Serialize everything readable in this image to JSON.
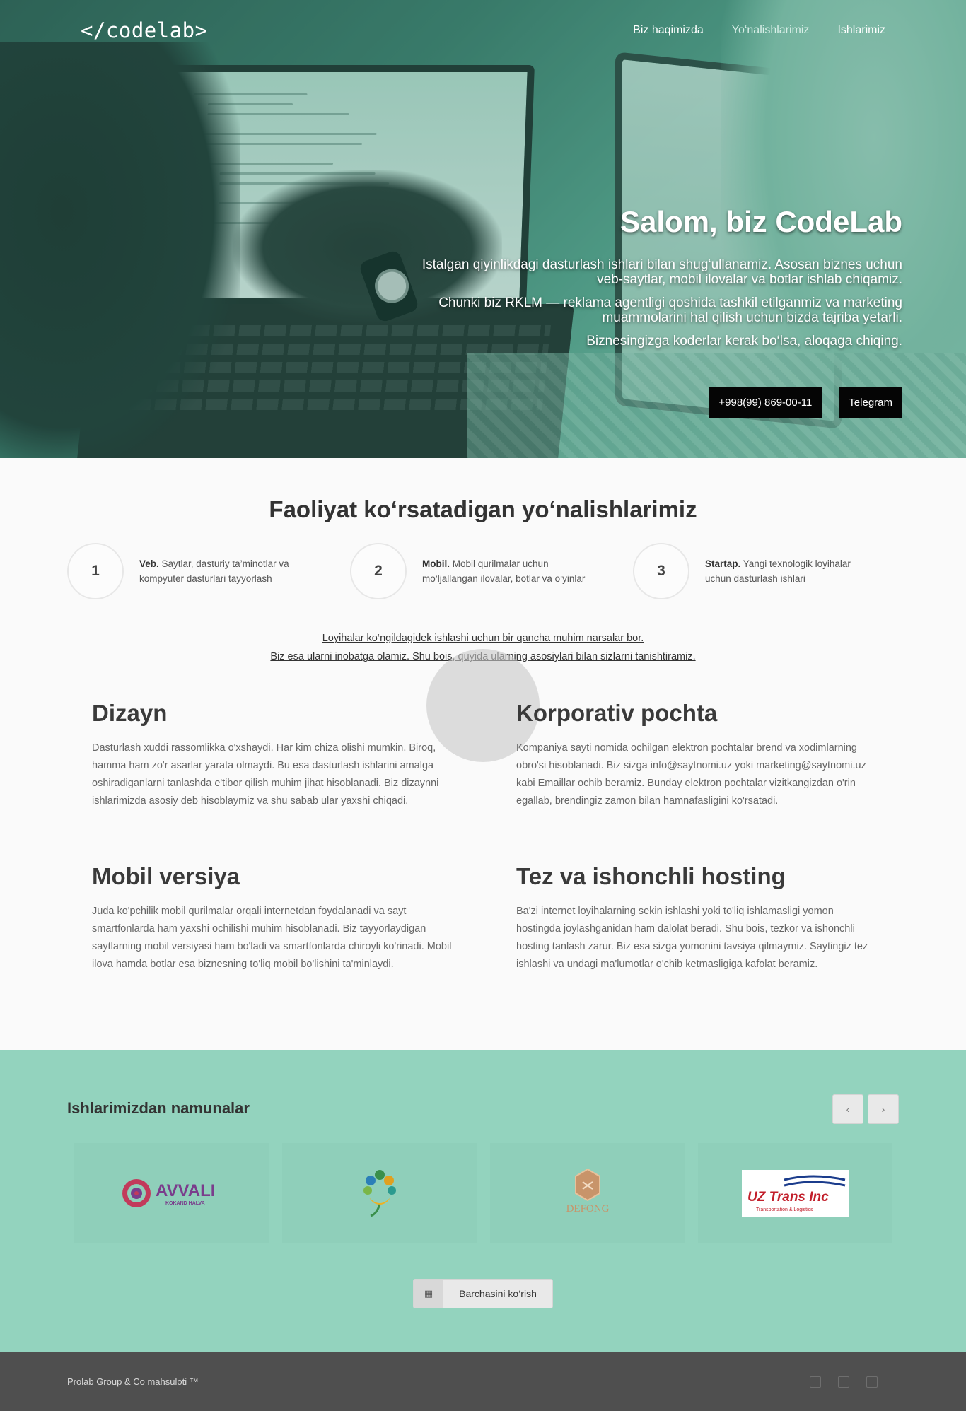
{
  "header": {
    "logo": "</codelab>",
    "nav": [
      "Biz haqimizda",
      "Yo‘nalishlarimiz",
      "Ishlarimiz"
    ]
  },
  "hero": {
    "title": "Salom, biz CodeLab",
    "p1": "Istalgan qiyinlikdagi dasturlash ishlari bilan shug‘ullanamiz. Asosan biznes uchun veb-saytlar, mobil ilovalar va botlar ishlab chiqamiz.",
    "p2": "Chunki biz RKLM — reklama agentligi qoshida tashkil etilganmiz va marketing muammolarini hal qilish uchun bizda tajriba yetarli.",
    "p3": "Biznesingizga koderlar kerak bo‘lsa, aloqaga chiqing.",
    "phone_button": "+998(99) 869-00-11",
    "telegram_button": "Telegram"
  },
  "services": {
    "title": "Faoliyat ko‘rsatadigan yo‘nalishlarimiz",
    "items": [
      {
        "num": "1",
        "name": "Veb.",
        "text": "Saytlar, dasturiy ta’minotlar va kompyuter dasturlari tayyorlash"
      },
      {
        "num": "2",
        "name": "Mobil.",
        "text": "Mobil qurilmalar uchun mo‘ljallangan ilovalar, botlar va o‘yinlar"
      },
      {
        "num": "3",
        "name": "Startap.",
        "text": "Yangi texnologik loyihalar uchun dasturlash ishlari"
      }
    ],
    "intro_line1": "Loyihalar ko‘ngildagidek ishlashi uchun bir qancha muhim narsalar bor.",
    "intro_line2": "Biz esa ularni inobatga olamiz. Shu bois, quyida ularning asosiylari bilan sizlarni tanishtiramiz."
  },
  "features": [
    {
      "title": "Dizayn",
      "text": "Dasturlash xuddi rassomlikka o'xshaydi. Har kim chiza olishi mumkin. Biroq, hamma ham zo'r asarlar yarata olmaydi. Bu esa dasturlash ishlarini amalga oshiradiganlarni tanlashda e'tibor qilish muhim jihat hisoblanadi. Biz dizaynni ishlarimizda asosiy deb hisoblaymiz va shu sabab ular yaxshi chiqadi."
    },
    {
      "title": "Korporativ pochta",
      "text": "Kompaniya sayti nomida ochilgan elektron pochtalar brend va xodimlarning obro'si hisoblanadi. Biz sizga info@saytnomi.uz yoki marketing@saytnomi.uz kabi Emaillar ochib beramiz. Bunday elektron pochtalar vizitkangizdan o'rin egallab, brendingiz zamon bilan hamnafasligini ko'rsatadi."
    },
    {
      "title": "Mobil versiya",
      "text": "Juda ko'pchilik mobil qurilmalar orqali internetdan foydalanadi va sayt smartfonlarda ham yaxshi ochilishi muhim hisoblanadi. Biz tayyorlaydigan saytlarning mobil versiyasi ham bo'ladi va smartfonlarda chiroyli ko'rinadi. Mobil ilova hamda botlar esa biznesning to'liq mobil bo'lishini ta'minlaydi."
    },
    {
      "title": "Tez va ishonchli hosting",
      "text": "Ba'zi internet loyihalarning sekin ishlashi yoki to'liq ishlamasligi yomon hostingda joylashganidan ham dalolat beradi. Shu bois, tezkor va ishonchli hosting tanlash zarur. Biz esa sizga yomonini tavsiya qilmaymiz. Saytingiz tez ishlashi va undagi ma'lumotlar o'chib ketmasligiga kafolat beramiz."
    }
  ],
  "works": {
    "title": "Ishlarimizdan namunalar",
    "prev_icon": "chevron-left-icon",
    "next_icon": "chevron-right-icon",
    "logos": [
      {
        "name": "avvali-logo",
        "text": "AVVALI",
        "sub": "KOKAND HALVA"
      },
      {
        "name": "tree-hand-logo",
        "text": ""
      },
      {
        "name": "defong-logo",
        "text": "DEFONG"
      },
      {
        "name": "uz-trans-logo",
        "text": "UZ Trans Inc",
        "sub": "Transportation & Logistics"
      }
    ],
    "see_all": "Barchasini ko‘rish",
    "see_all_icon": "grid-icon"
  },
  "footer": {
    "copyright": "Prolab Group & Co mahsuloti ™",
    "social_icons": [
      "facebook-icon",
      "instagram-icon",
      "telegram-icon"
    ]
  },
  "colors": {
    "accent": "#93d3be",
    "footer": "#4f4f4f",
    "button_dark": "#050505"
  }
}
